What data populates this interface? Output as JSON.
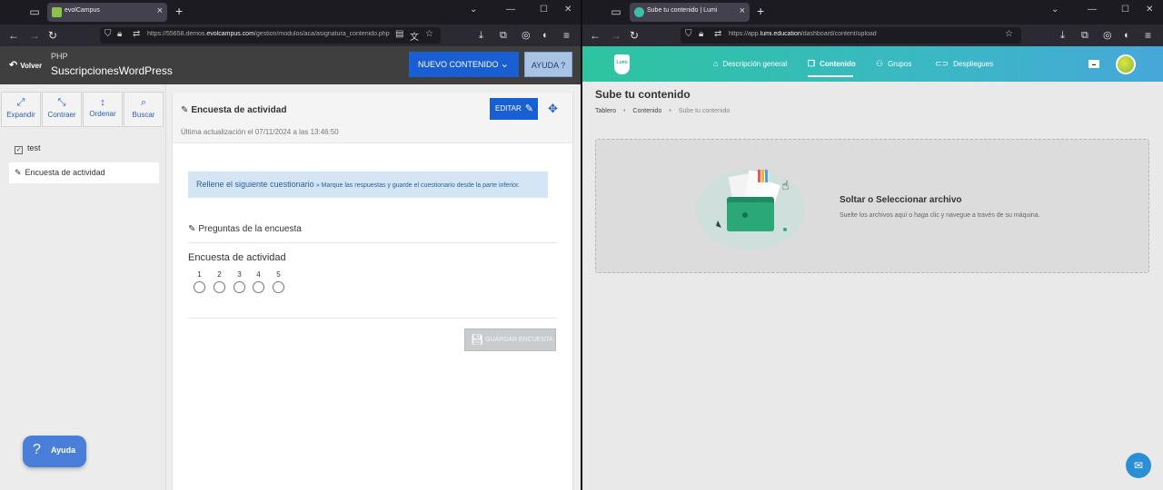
{
  "left_browser": {
    "tab_title": "evolCampus",
    "url_prefix": "https://55658.demos.",
    "url_domain": "evolcampus.com",
    "url_path": "/gestion/modulos/aca/asignatura_contenido.php"
  },
  "right_browser": {
    "tab_title": "Sube tu contenido | Lumi",
    "url_prefix": "https://app.",
    "url_domain": "lumi.education",
    "url_path": "/dashboard/content/upload"
  },
  "evol": {
    "back_label": "Volver",
    "category": "PHP",
    "course_title": "SuscripcionesWordPress",
    "new_content_label": "NUEVO CONTENIDO",
    "help_top_label": "AYUDA ?",
    "tools": [
      {
        "label": "Expandir",
        "icon": "expand-icon"
      },
      {
        "label": "Contraer",
        "icon": "collapse-icon"
      },
      {
        "label": "Ordenar",
        "icon": "sort-icon"
      },
      {
        "label": "Buscar",
        "icon": "search-icon"
      }
    ],
    "tree": [
      {
        "label": "test"
      },
      {
        "label": "Encuesta de actividad"
      }
    ],
    "content_title": "Encuesta de actividad",
    "last_update": "Última actualización el 07/11/2024 a las 13:46:50",
    "edit_label": "EDITAR",
    "info_lead": "Rellene el siguiente cuestionario",
    "info_rest": "» Marque las respuestas y guarde el cuestionario desde la parte inferior.",
    "section_title": "Preguntas de la encuesta",
    "question": "Encuesta de actividad",
    "scale": [
      "1",
      "2",
      "3",
      "4",
      "5"
    ],
    "save_label": "GUARDAR ENCUESTA",
    "help_label": "Ayuda"
  },
  "lumi": {
    "logo_text": "Lumi",
    "nav": [
      {
        "label": "Descripción general",
        "icon": "home-icon"
      },
      {
        "label": "Contenido",
        "icon": "copy-icon"
      },
      {
        "label": "Grupos",
        "icon": "groups-icon"
      },
      {
        "label": "Despliegues",
        "icon": "link-icon"
      }
    ],
    "page_title": "Sube tu contenido",
    "breadcrumbs": [
      "Tablero",
      "Contenido",
      "Sube tu contenido"
    ],
    "drop_title": "Soltar o Seleccionar archivo",
    "drop_subtitle": "Suelte los archivos aquí o haga clic y navegue a través de su máquina."
  }
}
